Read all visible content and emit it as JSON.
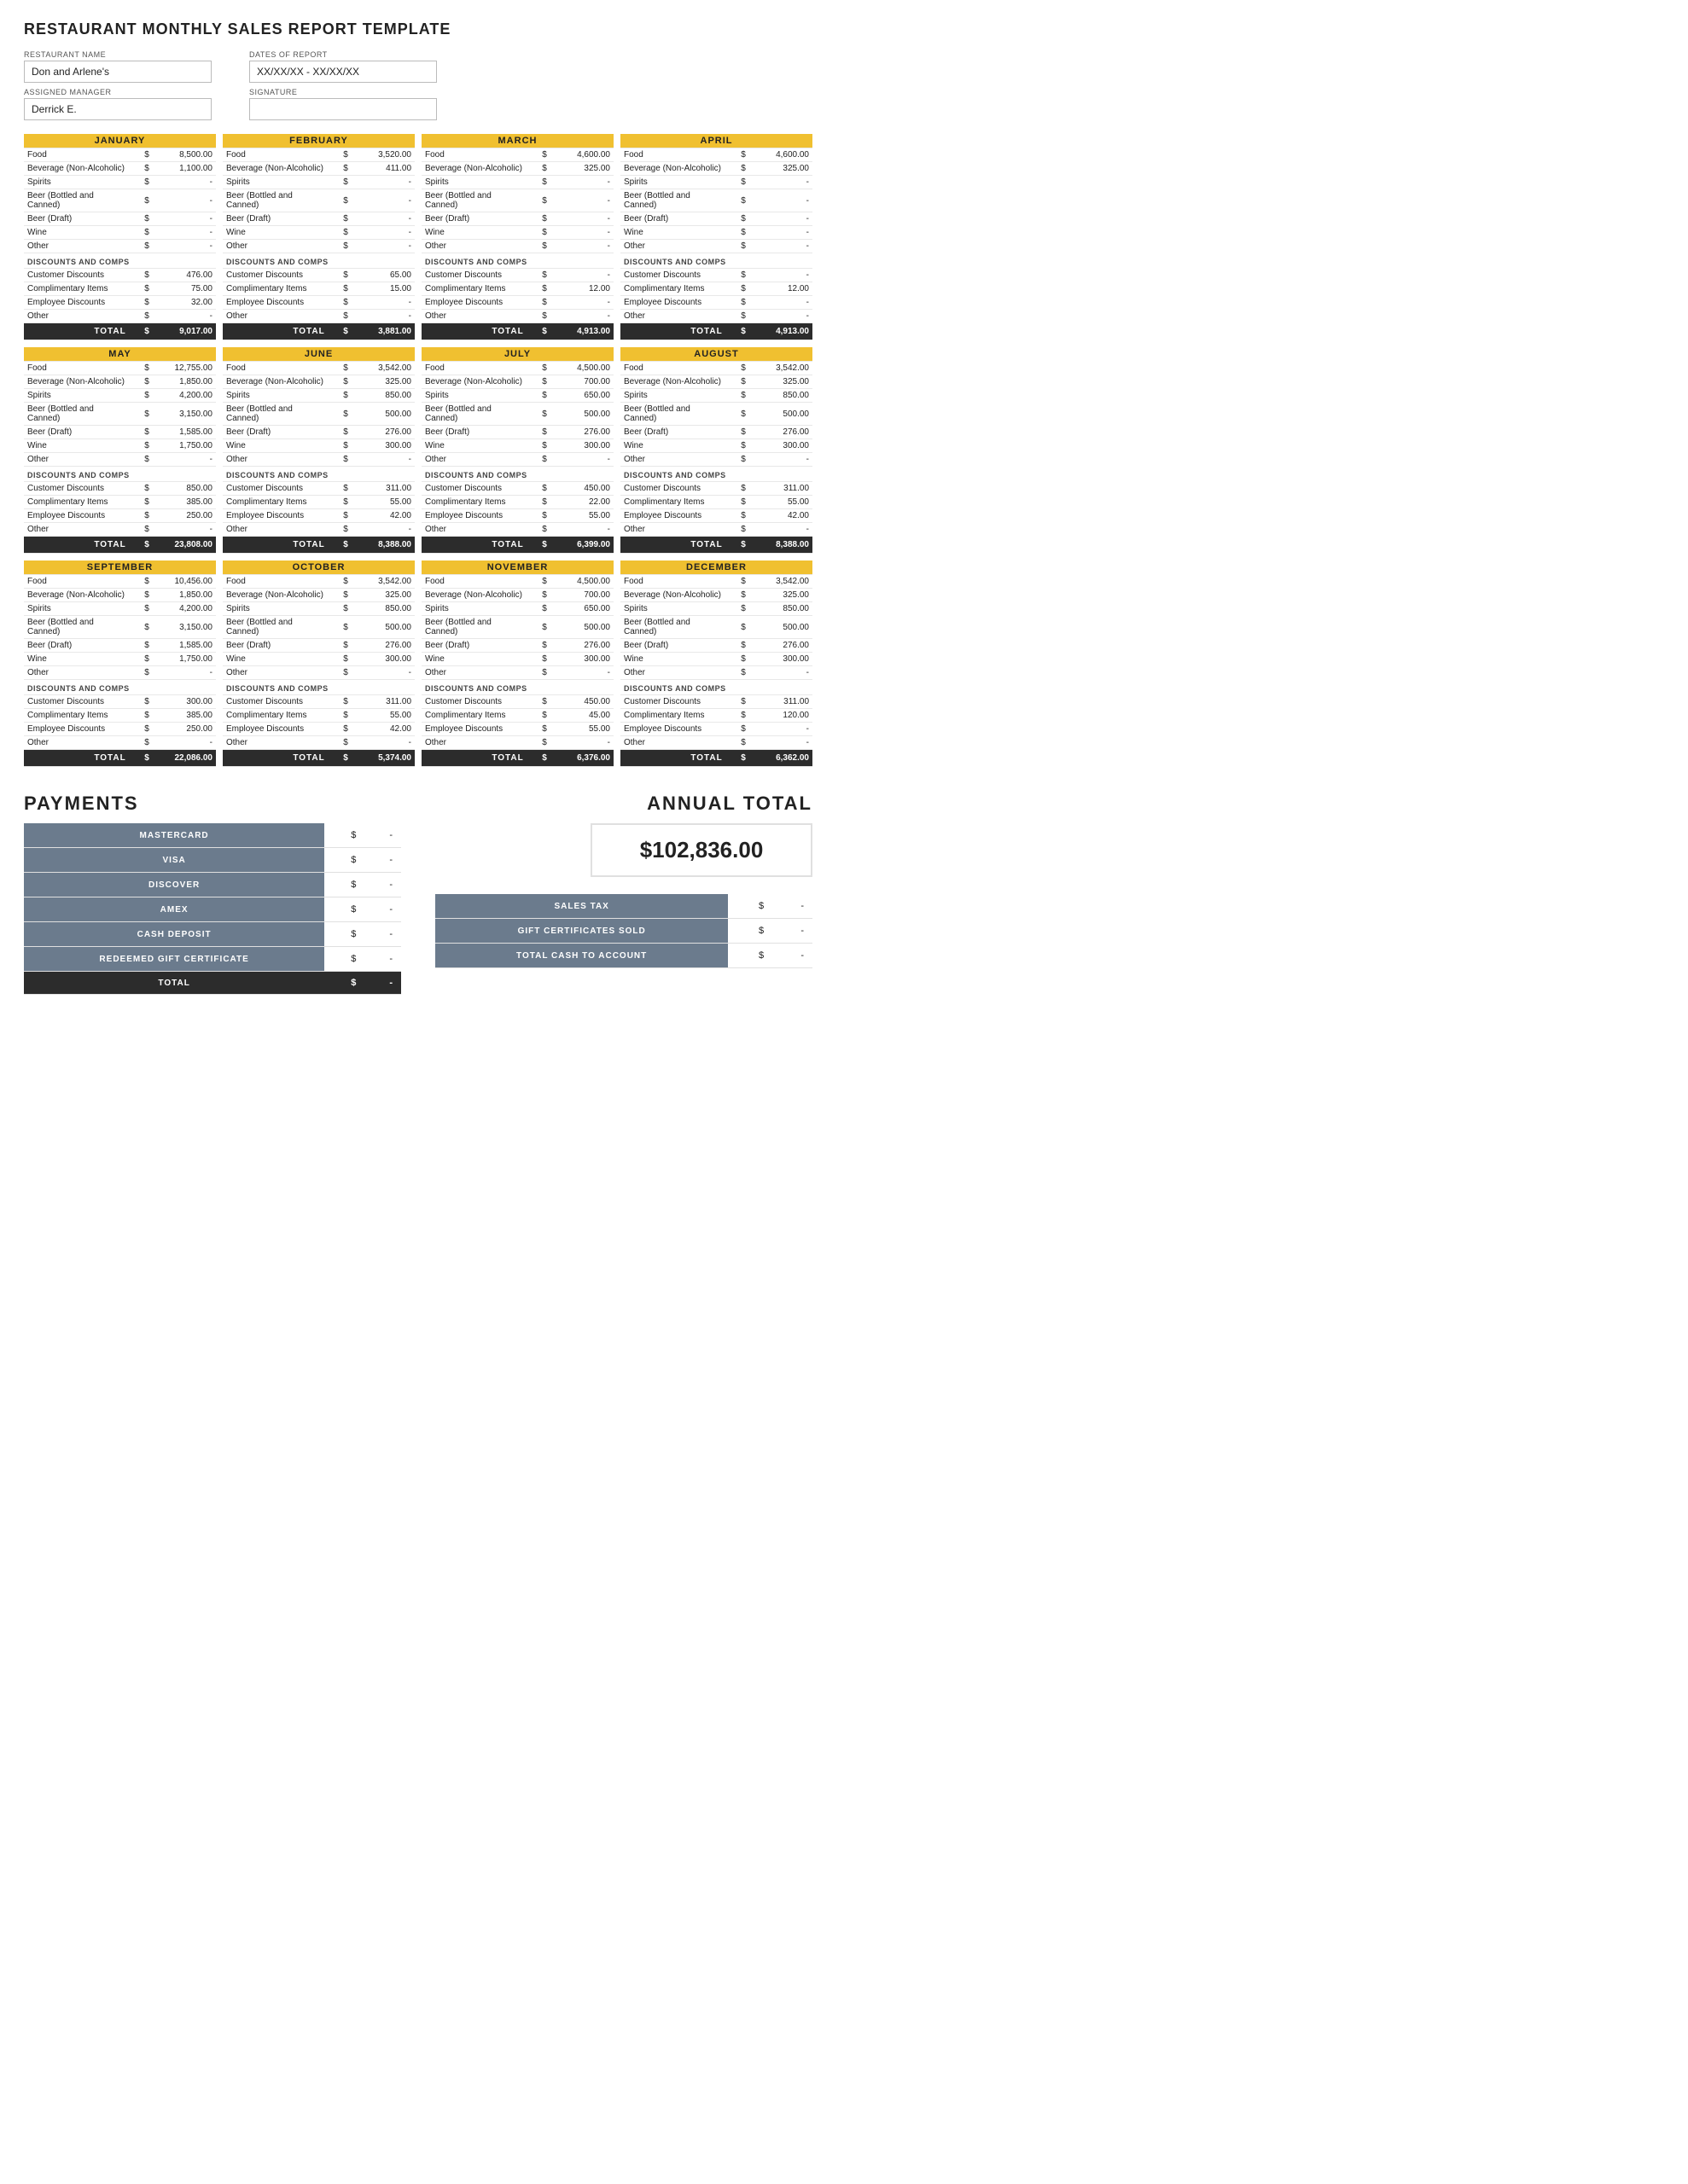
{
  "title": "RESTAURANT MONTHLY SALES REPORT TEMPLATE",
  "fields": {
    "restaurant_name_label": "RESTAURANT NAME",
    "restaurant_name_value": "Don and Arlene's",
    "dates_label": "DATES OF REPORT",
    "dates_value": "XX/XX/XX - XX/XX/XX",
    "manager_label": "ASSIGNED MANAGER",
    "manager_value": "Derrick E.",
    "signature_label": "SIGNATURE",
    "signature_value": ""
  },
  "months": [
    {
      "name": "JANUARY",
      "food": "8,500.00",
      "beverage": "1,100.00",
      "spirits": "-",
      "beer_bottled": "-",
      "beer_draft": "-",
      "wine": "-",
      "other": "-",
      "customer_discounts": "476.00",
      "complimentary": "75.00",
      "employee_discounts": "32.00",
      "other_disc": "-",
      "total": "9,017.00"
    },
    {
      "name": "FEBRUARY",
      "food": "3,520.00",
      "beverage": "411.00",
      "spirits": "-",
      "beer_bottled": "-",
      "beer_draft": "-",
      "wine": "-",
      "other": "-",
      "customer_discounts": "65.00",
      "complimentary": "15.00",
      "employee_discounts": "-",
      "other_disc": "-",
      "total": "3,881.00"
    },
    {
      "name": "MARCH",
      "food": "4,600.00",
      "beverage": "325.00",
      "spirits": "-",
      "beer_bottled": "-",
      "beer_draft": "-",
      "wine": "-",
      "other": "-",
      "customer_discounts": "-",
      "complimentary": "12.00",
      "employee_discounts": "-",
      "other_disc": "-",
      "total": "4,913.00"
    },
    {
      "name": "APRIL",
      "food": "4,600.00",
      "beverage": "325.00",
      "spirits": "-",
      "beer_bottled": "-",
      "beer_draft": "-",
      "wine": "-",
      "other": "-",
      "customer_discounts": "-",
      "complimentary": "12.00",
      "employee_discounts": "-",
      "other_disc": "-",
      "total": "4,913.00"
    },
    {
      "name": "MAY",
      "food": "12,755.00",
      "beverage": "1,850.00",
      "spirits": "4,200.00",
      "beer_bottled": "3,150.00",
      "beer_draft": "1,585.00",
      "wine": "1,750.00",
      "other": "-",
      "customer_discounts": "850.00",
      "complimentary": "385.00",
      "employee_discounts": "250.00",
      "other_disc": "-",
      "total": "23,808.00"
    },
    {
      "name": "JUNE",
      "food": "3,542.00",
      "beverage": "325.00",
      "spirits": "850.00",
      "beer_bottled": "500.00",
      "beer_draft": "276.00",
      "wine": "300.00",
      "other": "-",
      "customer_discounts": "311.00",
      "complimentary": "55.00",
      "employee_discounts": "42.00",
      "other_disc": "-",
      "total": "8,388.00"
    },
    {
      "name": "JULY",
      "food": "4,500.00",
      "beverage": "700.00",
      "spirits": "650.00",
      "beer_bottled": "500.00",
      "beer_draft": "276.00",
      "wine": "300.00",
      "other": "-",
      "customer_discounts": "450.00",
      "complimentary": "22.00",
      "employee_discounts": "55.00",
      "other_disc": "-",
      "total": "6,399.00"
    },
    {
      "name": "AUGUST",
      "food": "3,542.00",
      "beverage": "325.00",
      "spirits": "850.00",
      "beer_bottled": "500.00",
      "beer_draft": "276.00",
      "wine": "300.00",
      "other": "-",
      "customer_discounts": "311.00",
      "complimentary": "55.00",
      "employee_discounts": "42.00",
      "other_disc": "-",
      "total": "8,388.00"
    },
    {
      "name": "SEPTEMBER",
      "food": "10,456.00",
      "beverage": "1,850.00",
      "spirits": "4,200.00",
      "beer_bottled": "3,150.00",
      "beer_draft": "1,585.00",
      "wine": "1,750.00",
      "other": "-",
      "customer_discounts": "300.00",
      "complimentary": "385.00",
      "employee_discounts": "250.00",
      "other_disc": "-",
      "total": "22,086.00"
    },
    {
      "name": "OCTOBER",
      "food": "3,542.00",
      "beverage": "325.00",
      "spirits": "850.00",
      "beer_bottled": "500.00",
      "beer_draft": "276.00",
      "wine": "300.00",
      "other": "-",
      "customer_discounts": "311.00",
      "complimentary": "55.00",
      "employee_discounts": "42.00",
      "other_disc": "-",
      "total": "5,374.00"
    },
    {
      "name": "NOVEMBER",
      "food": "4,500.00",
      "beverage": "700.00",
      "spirits": "650.00",
      "beer_bottled": "500.00",
      "beer_draft": "276.00",
      "wine": "300.00",
      "other": "-",
      "customer_discounts": "450.00",
      "complimentary": "45.00",
      "employee_discounts": "55.00",
      "other_disc": "-",
      "total": "6,376.00"
    },
    {
      "name": "DECEMBER",
      "food": "3,542.00",
      "beverage": "325.00",
      "spirits": "850.00",
      "beer_bottled": "500.00",
      "beer_draft": "276.00",
      "wine": "300.00",
      "other": "-",
      "customer_discounts": "311.00",
      "complimentary": "120.00",
      "employee_discounts": "-",
      "other_disc": "-",
      "total": "6,362.00"
    }
  ],
  "row_labels": {
    "food": "Food",
    "beverage": "Beverage (Non-Alcoholic)",
    "spirits": "Spirits",
    "beer_bottled": "Beer (Bottled and Canned)",
    "beer_draft": "Beer (Draft)",
    "wine": "Wine",
    "other": "Other",
    "discounts_comps": "DISCOUNTS AND COMPS",
    "customer_discounts": "Customer Discounts",
    "complimentary": "Complimentary Items",
    "employee_discounts": "Employee Discounts",
    "other_disc": "Other",
    "total": "TOTAL"
  },
  "payments": {
    "title": "PAYMENTS",
    "rows": [
      {
        "label": "MASTERCARD",
        "dollar": "$",
        "value": "-"
      },
      {
        "label": "VISA",
        "dollar": "$",
        "value": "-"
      },
      {
        "label": "DISCOVER",
        "dollar": "$",
        "value": "-"
      },
      {
        "label": "AMEX",
        "dollar": "$",
        "value": "-"
      },
      {
        "label": "CASH DEPOSIT",
        "dollar": "$",
        "value": "-"
      },
      {
        "label": "REDEEMED GIFT CERTIFICATE",
        "dollar": "$",
        "value": "-"
      }
    ],
    "total_label": "TOTAL",
    "total_dollar": "$",
    "total_value": "-"
  },
  "annual": {
    "title": "ANNUAL TOTAL",
    "amount": "$102,836.00",
    "tax_rows": [
      {
        "label": "SALES TAX",
        "dollar": "$",
        "value": "-"
      },
      {
        "label": "GIFT CERTIFICATES SOLD",
        "dollar": "$",
        "value": "-"
      },
      {
        "label": "TOTAL CASH TO ACCOUNT",
        "dollar": "$",
        "value": "-"
      }
    ]
  }
}
